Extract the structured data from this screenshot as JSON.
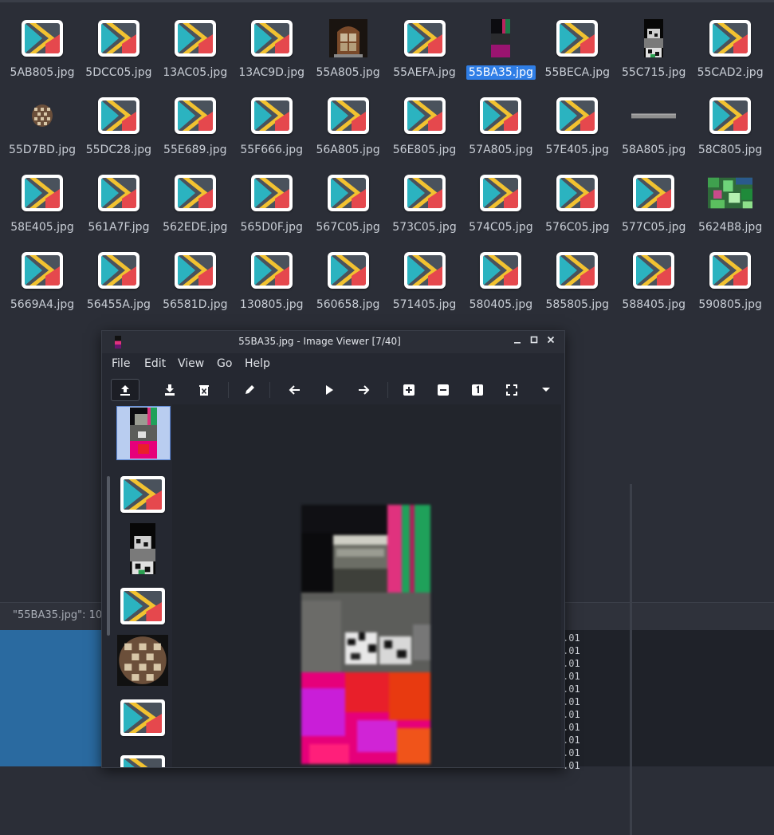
{
  "file_manager": {
    "files": [
      {
        "name": "5AB805.jpg",
        "thumb": "app"
      },
      {
        "name": "5DCC05.jpg",
        "thumb": "app"
      },
      {
        "name": "13AC05.jpg",
        "thumb": "app"
      },
      {
        "name": "13AC9D.jpg",
        "thumb": "app"
      },
      {
        "name": "55A805.jpg",
        "thumb": "door"
      },
      {
        "name": "55AEFA.jpg",
        "thumb": "app"
      },
      {
        "name": "55BA35.jpg",
        "thumb": "dark",
        "selected": true
      },
      {
        "name": "55BECA.jpg",
        "thumb": "app"
      },
      {
        "name": "55C715.jpg",
        "thumb": "glitch"
      },
      {
        "name": "55CAD2.jpg",
        "thumb": "app"
      },
      {
        "name": "55D7BD.jpg",
        "thumb": "pot"
      },
      {
        "name": "55DC28.jpg",
        "thumb": "app"
      },
      {
        "name": "55E689.jpg",
        "thumb": "app"
      },
      {
        "name": "55F666.jpg",
        "thumb": "app"
      },
      {
        "name": "56A805.jpg",
        "thumb": "app"
      },
      {
        "name": "56E805.jpg",
        "thumb": "app"
      },
      {
        "name": "57A805.jpg",
        "thumb": "app"
      },
      {
        "name": "57E405.jpg",
        "thumb": "app"
      },
      {
        "name": "58A805.jpg",
        "thumb": "bar"
      },
      {
        "name": "58C805.jpg",
        "thumb": "app"
      },
      {
        "name": "58E405.jpg",
        "thumb": "app"
      },
      {
        "name": "561A7F.jpg",
        "thumb": "app"
      },
      {
        "name": "562EDE.jpg",
        "thumb": "app"
      },
      {
        "name": "565D0F.jpg",
        "thumb": "app"
      },
      {
        "name": "567C05.jpg",
        "thumb": "app"
      },
      {
        "name": "573C05.jpg",
        "thumb": "app"
      },
      {
        "name": "574C05.jpg",
        "thumb": "app"
      },
      {
        "name": "576C05.jpg",
        "thumb": "app"
      },
      {
        "name": "577C05.jpg",
        "thumb": "app"
      },
      {
        "name": "5624B8.jpg",
        "thumb": "green"
      },
      {
        "name": "5669A4.jpg",
        "thumb": "app"
      },
      {
        "name": "56455A.jpg",
        "thumb": "app"
      },
      {
        "name": "56581D.jpg",
        "thumb": "app"
      },
      {
        "name": "130805.jpg",
        "thumb": "app"
      },
      {
        "name": "560658.jpg",
        "thumb": "app"
      },
      {
        "name": "571405.jpg",
        "thumb": "app"
      },
      {
        "name": "580405.jpg",
        "thumb": "app"
      },
      {
        "name": "585805.jpg",
        "thumb": "app"
      },
      {
        "name": "588405.jpg",
        "thumb": "app"
      },
      {
        "name": "590805.jpg",
        "thumb": "app"
      }
    ],
    "status_text": "\"55BA35.jpg\": 10"
  },
  "terminal": {
    "lines": [
      ".01",
      ".01",
      ".01",
      ".01",
      ".01",
      ".01",
      ".01",
      ".01",
      ".01",
      ".01",
      ".01"
    ]
  },
  "viewer": {
    "title": "55BA35.jpg - Image Viewer [7/40]",
    "menus": [
      "File",
      "Edit",
      "View",
      "Go",
      "Help"
    ],
    "window_buttons": {
      "minimize": "minimize",
      "maximize": "maximize",
      "close": "close"
    },
    "toolbar_icons": [
      "upload-icon",
      "save-icon",
      "delete-icon",
      "edit-icon",
      "previous-icon",
      "play-icon",
      "next-icon",
      "zoom-in-icon",
      "zoom-out-icon",
      "actual-size-icon",
      "fullscreen-icon",
      "more-icon"
    ],
    "sidebar_thumbs": [
      "current",
      "app",
      "glitch",
      "app",
      "pot",
      "app",
      "app"
    ]
  },
  "colors": {
    "accent": "#2f7ee6",
    "app_teal": "#2bb3c0",
    "app_yellow": "#f2c230",
    "app_red": "#e5484d"
  }
}
